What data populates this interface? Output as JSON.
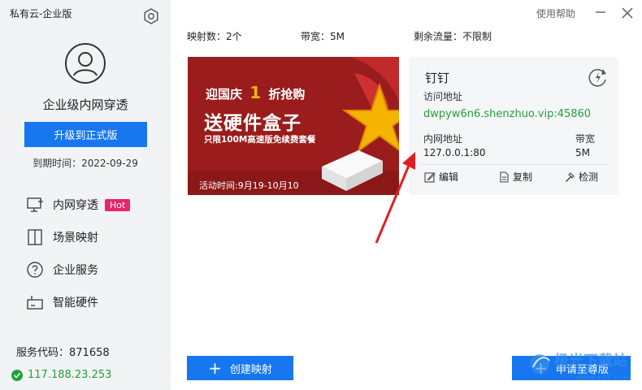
{
  "app": {
    "title": "私有云-企业版"
  },
  "sidebar": {
    "product_name": "企业级内网穿透",
    "upgrade_label": "升级到正式版",
    "expire_label": "到期时间：2022-09-29",
    "nav": [
      {
        "label": "内网穿透",
        "badge": "Hot",
        "icon": "monitor-icon"
      },
      {
        "label": "场景映射",
        "icon": "split-panel-icon"
      },
      {
        "label": "企业服务",
        "icon": "question-icon"
      },
      {
        "label": "智能硬件",
        "icon": "hardware-box-icon"
      }
    ],
    "service_code": "服务代码：871658",
    "ip": "117.188.23.253"
  },
  "topbar": {
    "help": "使用帮助"
  },
  "stats": {
    "mappings": "映射数：2个",
    "bandwidth": "带宽：5M",
    "traffic": "剩余流量：不限制"
  },
  "banner": {
    "line1a": "迎国庆",
    "line1b": "1",
    "line1c": "折抢购",
    "line2": "送硬件盒子",
    "line3": "只限100M高速版免续费套餐",
    "line4": "活动时间:9月19-10月10",
    "colors": {
      "bg": "#9b1c1c",
      "accent": "#f4b400"
    }
  },
  "card": {
    "title": "钉钉",
    "access_label": "访问地址",
    "access_url": "dwpyw6n6.shenzhuo.vip:45860",
    "lan_label": "内网地址",
    "lan_value": "127.0.0.1:80",
    "bw_label": "带宽",
    "bw_value": "5M",
    "actions": {
      "edit": "编辑",
      "copy": "复制",
      "detect": "检测"
    }
  },
  "buttons": {
    "create": "创建映射",
    "apply": "申请至尊版"
  },
  "watermark": {
    "text": "极光下载站",
    "url": "www.xz7.com"
  },
  "colors": {
    "primary": "#1677f0",
    "success": "#23a03c",
    "hot": "#e8246b"
  }
}
